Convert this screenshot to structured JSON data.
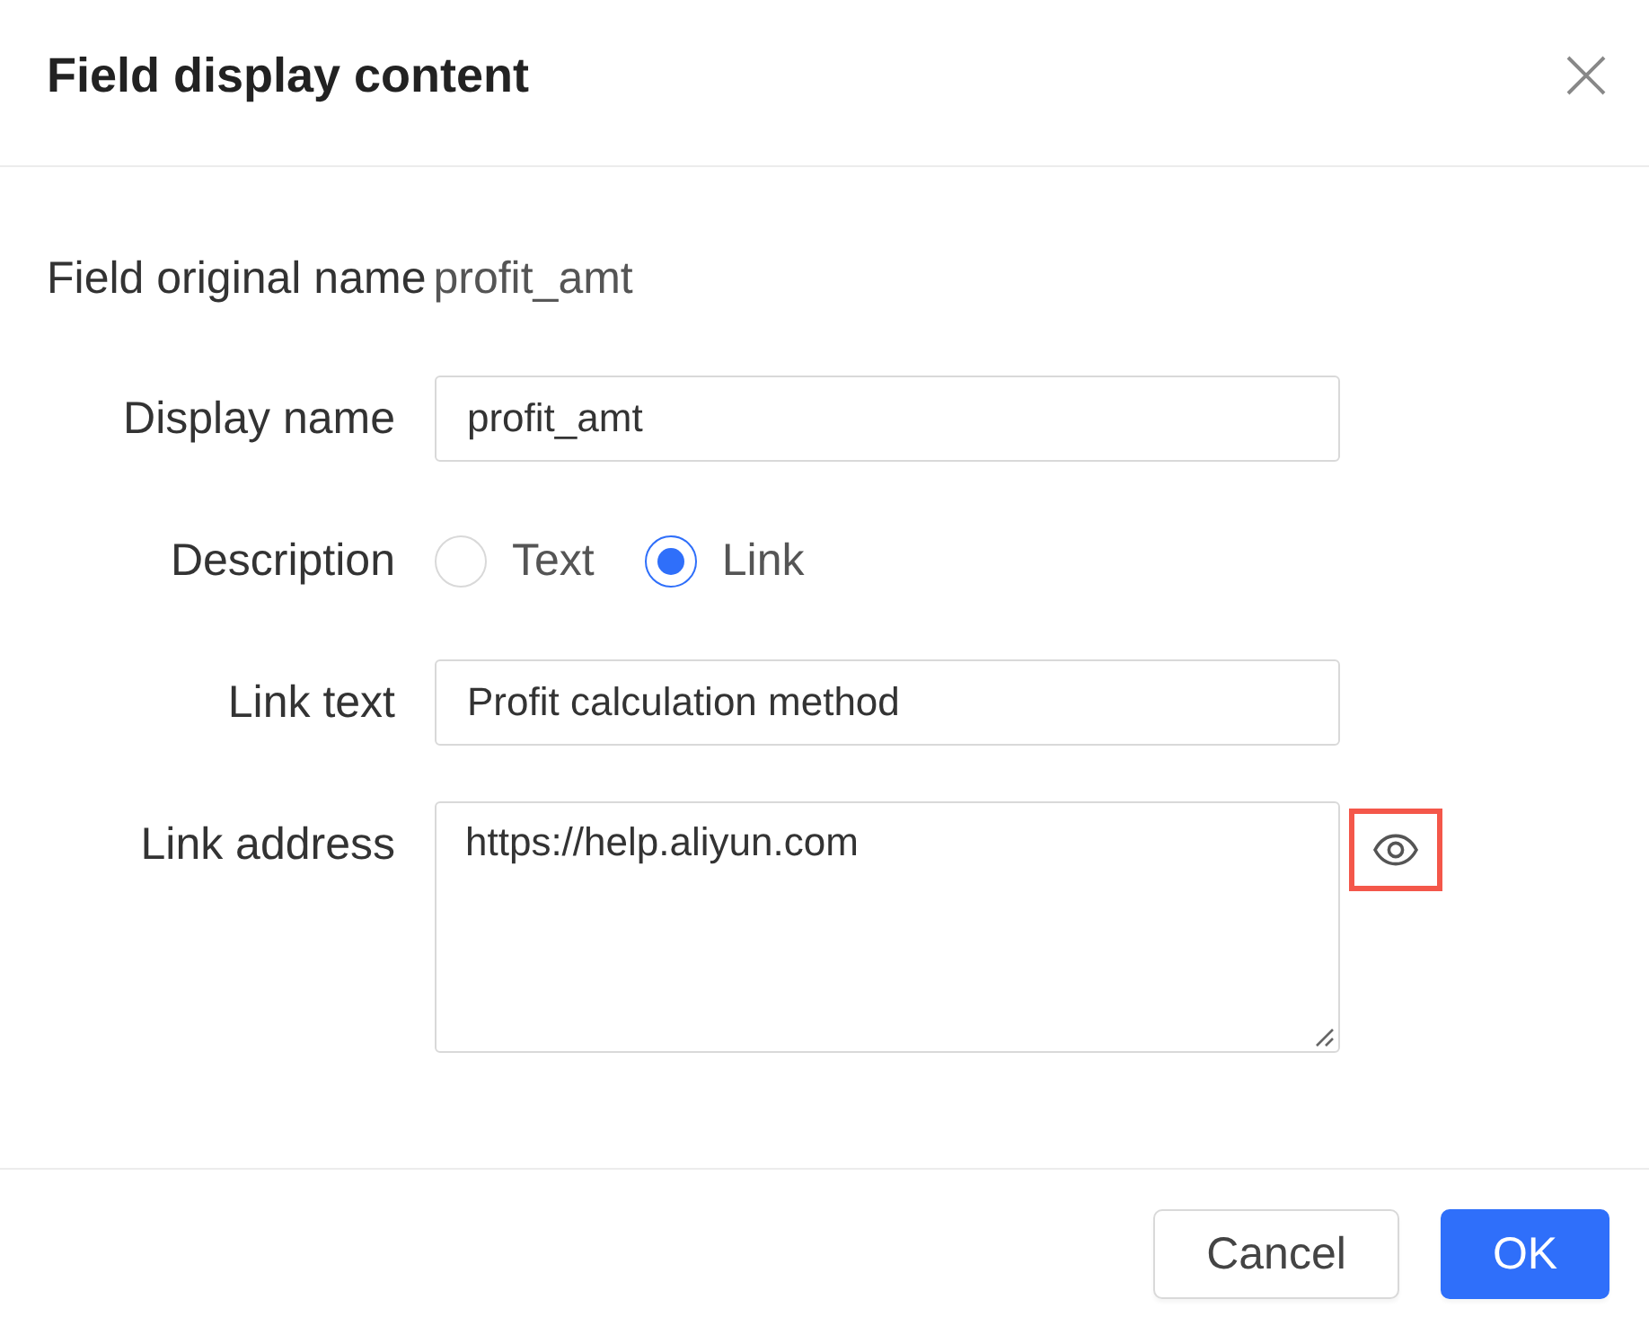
{
  "dialog": {
    "title": "Field display content"
  },
  "original_name": {
    "label": "Field original name",
    "value": "profit_amt"
  },
  "display_name": {
    "label": "Display name",
    "value": "profit_amt"
  },
  "description": {
    "label": "Description",
    "options": [
      {
        "label": "Text",
        "selected": false
      },
      {
        "label": "Link",
        "selected": true
      }
    ]
  },
  "link_text": {
    "label": "Link text",
    "value": "Profit calculation method"
  },
  "link_address": {
    "label": "Link address",
    "value": "https://help.aliyun.com",
    "preview_highlighted": true
  },
  "buttons": [
    {
      "label": "Cancel",
      "kind": "secondary"
    },
    {
      "label": "OK",
      "kind": "primary"
    }
  ]
}
